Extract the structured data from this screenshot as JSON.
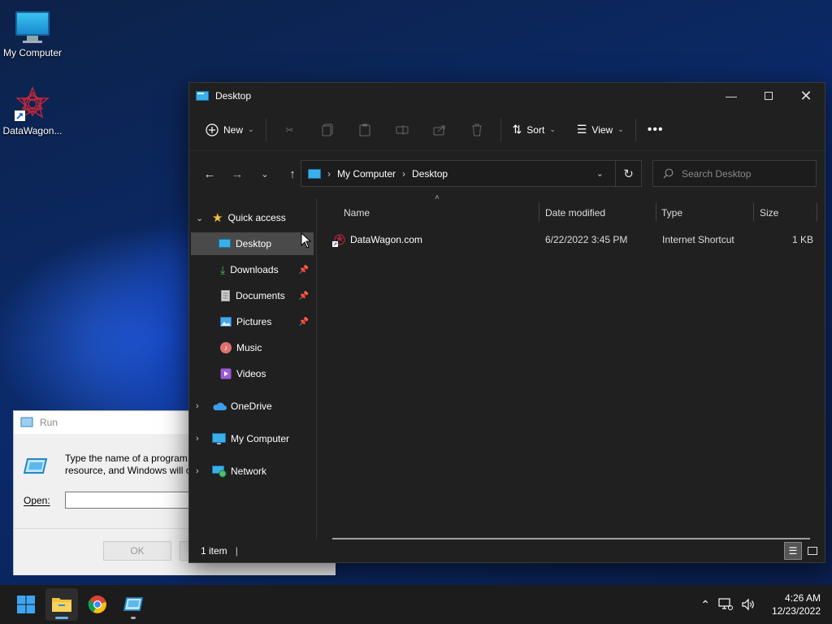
{
  "desktop": {
    "icons": [
      {
        "label": "My Computer"
      },
      {
        "label": "DataWagon..."
      }
    ]
  },
  "explorer": {
    "title": "Desktop",
    "toolbar": {
      "new_label": "New",
      "sort_label": "Sort",
      "view_label": "View"
    },
    "address": {
      "root": "My Computer",
      "current": "Desktop"
    },
    "search": {
      "placeholder": "Search Desktop"
    },
    "nav": {
      "quick_access": "Quick access",
      "items": [
        {
          "label": "Desktop"
        },
        {
          "label": "Downloads"
        },
        {
          "label": "Documents"
        },
        {
          "label": "Pictures"
        },
        {
          "label": "Music"
        },
        {
          "label": "Videos"
        }
      ],
      "onedrive": "OneDrive",
      "my_computer": "My Computer",
      "network": "Network"
    },
    "columns": {
      "name": "Name",
      "date": "Date modified",
      "type": "Type",
      "size": "Size"
    },
    "files": [
      {
        "name": "DataWagon.com",
        "date": "6/22/2022 3:45 PM",
        "type": "Internet Shortcut",
        "size": "1 KB"
      }
    ],
    "status": {
      "count": "1 item"
    }
  },
  "run": {
    "title": "Run",
    "description_line1": "Type the name of a program,",
    "description_line2": "resource, and Windows will o",
    "open_label": "Open:",
    "ok_label": "OK"
  },
  "taskbar": {
    "time": "4:26 AM",
    "date": "12/23/2022"
  },
  "colors": {
    "accent": "#3b8eea",
    "window_bg": "#202020",
    "selection": "#4a4a4a"
  }
}
